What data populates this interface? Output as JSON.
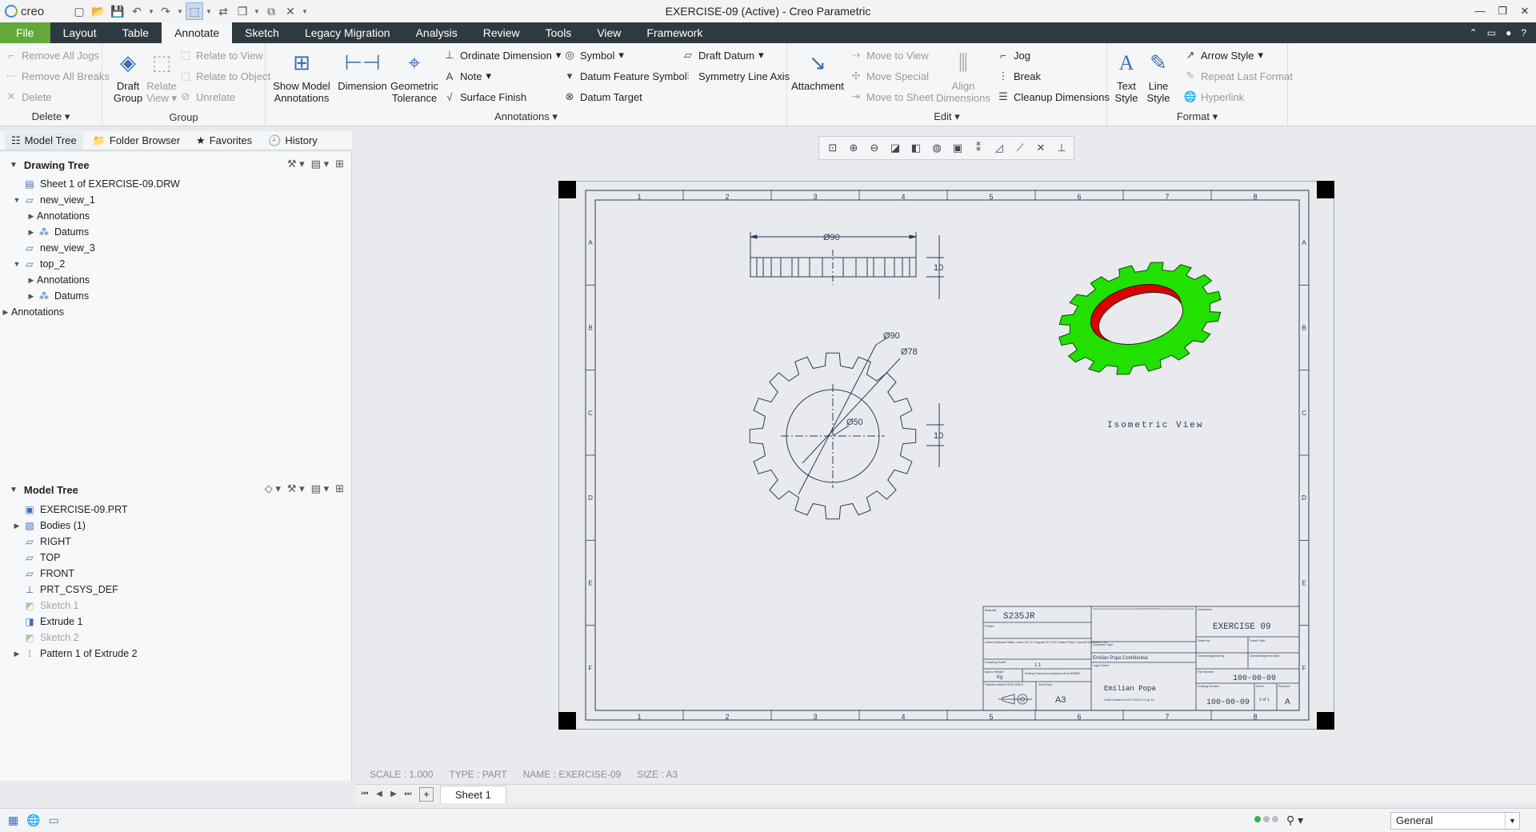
{
  "app": {
    "brand": "creo",
    "window_title": "EXERCISE-09 (Active) - Creo Parametric"
  },
  "menu": {
    "tabs": [
      "File",
      "Layout",
      "Table",
      "Annotate",
      "Sketch",
      "Legacy Migration",
      "Analysis",
      "Review",
      "Tools",
      "View",
      "Framework"
    ],
    "active": "Annotate"
  },
  "ribbon": {
    "delete": {
      "remove_all_jogs": "Remove All Jogs",
      "remove_all_breaks": "Remove All Breaks",
      "delete": "Delete",
      "label": "Delete"
    },
    "group": {
      "draft_group_l1": "Draft",
      "draft_group_l2": "Group",
      "relate_view_l1": "Relate",
      "relate_view_l2": "View",
      "relate_to_view": "Relate to View",
      "relate_to_object": "Relate to Object",
      "unrelate": "Unrelate",
      "label": "Group"
    },
    "annotations": {
      "show_model_l1": "Show Model",
      "show_model_l2": "Annotations",
      "dimension": "Dimension",
      "geom_tol_l1": "Geometric",
      "geom_tol_l2": "Tolerance",
      "ordinate_dimension": "Ordinate Dimension",
      "note": "Note",
      "surface_finish": "Surface Finish",
      "symbol": "Symbol",
      "datum_feature_symbol": "Datum Feature Symbol",
      "datum_target": "Datum Target",
      "draft_datum": "Draft Datum",
      "symmetry_line_axis": "Symmetry Line Axis",
      "label": "Annotations"
    },
    "edit": {
      "attachment": "Attachment",
      "move_to_view": "Move to View",
      "move_special": "Move Special",
      "move_to_sheet": "Move to Sheet",
      "align_l1": "Align",
      "align_l2": "Dimensions",
      "jog": "Jog",
      "break": "Break",
      "cleanup_dimensions": "Cleanup Dimensions",
      "label": "Edit"
    },
    "format": {
      "text_style_l1": "Text",
      "text_style_l2": "Style",
      "line_style_l1": "Line",
      "line_style_l2": "Style",
      "arrow_style": "Arrow Style",
      "repeat_last_format": "Repeat Last Format",
      "hyperlink": "Hyperlink",
      "label": "Format"
    }
  },
  "nav_tabs": {
    "model_tree": "Model Tree",
    "folder_browser": "Folder Browser",
    "favorites": "Favorites",
    "history": "History"
  },
  "drawing_tree": {
    "title": "Drawing Tree",
    "items": [
      {
        "label": "Sheet 1 of EXERCISE-09.DRW",
        "level": 0,
        "twisty": "",
        "icon": "sheet-icon"
      },
      {
        "label": "new_view_1",
        "level": 0,
        "twisty": "▼",
        "icon": "view-icon"
      },
      {
        "label": "Annotations",
        "level": 1,
        "twisty": "▶",
        "icon": ""
      },
      {
        "label": "Datums",
        "level": 1,
        "twisty": "▶",
        "icon": "datum-icon"
      },
      {
        "label": "new_view_3",
        "level": 0,
        "twisty": "",
        "icon": "view-icon"
      },
      {
        "label": "top_2",
        "level": 0,
        "twisty": "▼",
        "icon": "view-icon"
      },
      {
        "label": "Annotations",
        "level": 1,
        "twisty": "▶",
        "icon": ""
      },
      {
        "label": "Datums",
        "level": 1,
        "twisty": "▶",
        "icon": "datum-icon"
      },
      {
        "label": "Annotations",
        "level": -1,
        "twisty": "▶",
        "icon": ""
      }
    ]
  },
  "model_tree": {
    "title": "Model Tree",
    "items": [
      {
        "label": "EXERCISE-09.PRT",
        "twisty": "",
        "icon": "part-icon",
        "disabled": false
      },
      {
        "label": "Bodies (1)",
        "twisty": "▶",
        "icon": "body-icon",
        "disabled": false
      },
      {
        "label": "RIGHT",
        "twisty": "",
        "icon": "plane-icon",
        "disabled": false
      },
      {
        "label": "TOP",
        "twisty": "",
        "icon": "plane-icon",
        "disabled": false
      },
      {
        "label": "FRONT",
        "twisty": "",
        "icon": "plane-icon",
        "disabled": false
      },
      {
        "label": "PRT_CSYS_DEF",
        "twisty": "",
        "icon": "csys-icon",
        "disabled": false
      },
      {
        "label": "Sketch 1",
        "twisty": "",
        "icon": "sketch-icon",
        "disabled": true
      },
      {
        "label": "Extrude 1",
        "twisty": "",
        "icon": "extrude-icon",
        "disabled": false
      },
      {
        "label": "Sketch 2",
        "twisty": "",
        "icon": "sketch-icon",
        "disabled": true
      },
      {
        "label": "Pattern 1 of Extrude 2",
        "twisty": "▶",
        "icon": "pattern-icon",
        "disabled": false
      }
    ]
  },
  "drawing": {
    "zone_numbers": [
      "1",
      "2",
      "3",
      "4",
      "5",
      "6",
      "7",
      "8"
    ],
    "zone_letters": [
      "A",
      "B",
      "C",
      "D",
      "E",
      "F"
    ],
    "dims": {
      "d90_top": "Ø90",
      "t10_top": "10",
      "d90": "Ø90",
      "d78": "Ø78",
      "d50": "Ø50",
      "t10_front": "10"
    },
    "iso_label": "Isometric View",
    "title_block": {
      "material_label": "Material:",
      "material": "S235JR",
      "finish_label": "Finish:",
      "tolerances": "Unless Otherwise Stated: Linear Tol: ±0.1  Angular Tol: 0°15' Surface Finish 3.2µm  All Dimensions: mm",
      "confidential": "This drawing and any information or descriptive matter set out on are the confidential and copyright property of Emilian Popa and MUST NOT BE DISCLOSED, COPIED, LOANED in whole or part or used for any purpose without the written permission of Emilian Popa",
      "document_type_label": "Document Type:",
      "confidential_short": "Emilian Popa Confidential",
      "drawing_scale_label": "Drawing Scale:",
      "drawing_scale": "1:1",
      "approx_weight_label": "Approx Weight:",
      "approx_weight": "Kg",
      "drawing_produced": "Drawing Produced to Acceptance Work: BS8888",
      "projection_label": "Projection Method: FIRST ANGLE",
      "sheet_size_label": "Sheet Size:",
      "sheet_size": "A3",
      "legal_owner_label": "Legal Owner:",
      "legal_owner": "Emilian Popa",
      "date_line": "Draft Created on 02.07.2022 in 1 op 10",
      "description_label": "Description:",
      "description": "EXERCISE 09",
      "drawn_by_label": "Drawn by:",
      "drawn_date_label": "Drawn Date:",
      "checked_label": "Checked/Approved by:",
      "checked_date_label": "Checked/Approved Date:",
      "part_number_label": "Part Number:",
      "part_number": "100-00-09",
      "drawing_number_label": "Drawing Number:",
      "drawing_number": "100-00-09",
      "sheet_label": "Sheet:",
      "sheet": "1 of 1",
      "revision_label": "Revision:",
      "revision": "A"
    },
    "colors": {
      "gear_face": "#22e000",
      "gear_bore": "#d90000",
      "line": "#2d3a5a"
    }
  },
  "info": {
    "scale": "SCALE : 1.000",
    "type": "TYPE : PART",
    "name": "NAME : EXERCISE-09",
    "size": "SIZE : A3"
  },
  "sheet_tab": "Sheet 1",
  "status": {
    "filter": "General"
  }
}
